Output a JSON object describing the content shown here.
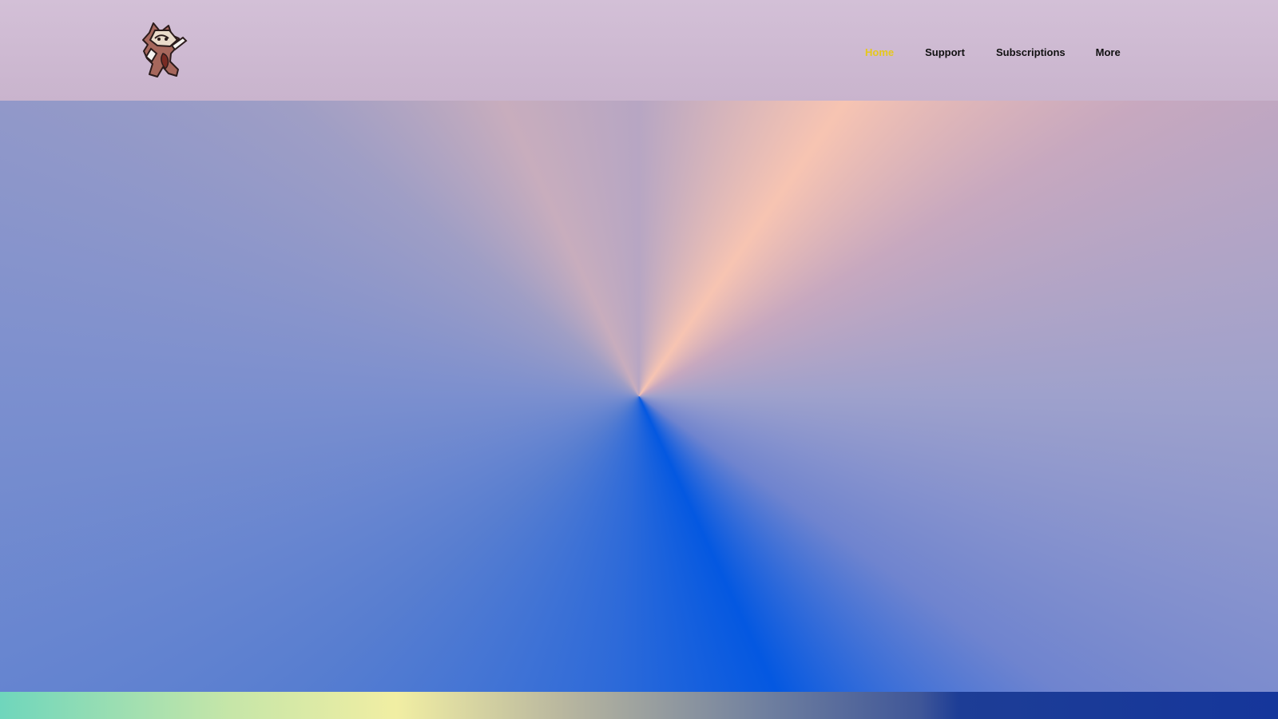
{
  "header": {
    "logo_icon": "cartoon-raccoon-mascot-icon"
  },
  "nav": {
    "items": [
      {
        "label": "Home",
        "active": true
      },
      {
        "label": "Support",
        "active": false
      },
      {
        "label": "Subscriptions",
        "active": false
      },
      {
        "label": "More",
        "active": false
      }
    ]
  },
  "colors": {
    "header_bg": "#cfbfd5",
    "nav_active": "#e6c81a",
    "nav_text": "#111111",
    "hero_primary": "#0458e1",
    "hero_highlight": "#f7c4b2",
    "footer_gradient_start": "#6fd6bc",
    "footer_gradient_end": "#15369b"
  }
}
